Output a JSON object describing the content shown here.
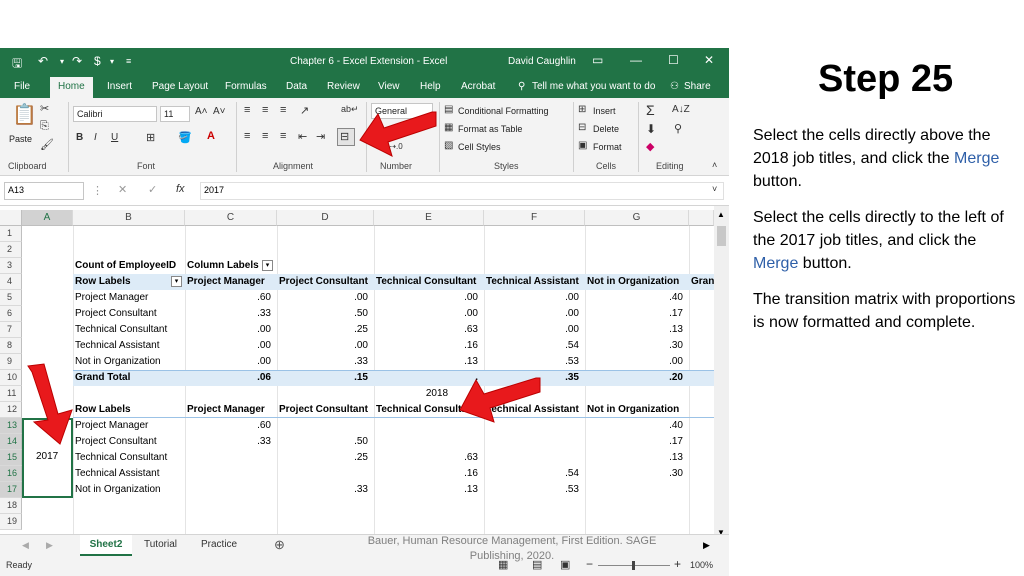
{
  "slide": {
    "step_title": "Step 25",
    "para1_before": "Select the cells directly above the 2018 job titles, and click the ",
    "para1_link": "Merge",
    "para1_after": " button.",
    "para2_before": "Select the cells directly to the left of the 2017 job titles, and click the ",
    "para2_link": "Merge",
    "para2_after": " button.",
    "para3": "The transition matrix with proportions is now formatted and complete.",
    "citation": "Bauer, Human Resource Management, First Edition. SAGE Publishing, 2020."
  },
  "window": {
    "title": "Chapter 6 - Excel Extension  -  Excel",
    "user": "David Caughlin"
  },
  "ribbon_tabs": [
    "File",
    "Home",
    "Insert",
    "Page Layout",
    "Formulas",
    "Data",
    "Review",
    "View",
    "Help",
    "Acrobat"
  ],
  "tell_me": "Tell me what you want to do",
  "share": "Share",
  "ribbon": {
    "paste": "Paste",
    "clipboard": "Clipboard",
    "font_name": "Calibri",
    "font_size": "11",
    "font": "Font",
    "alignment": "Alignment",
    "number_format": "General",
    "number": "Number",
    "conditional_formatting": "Conditional Formatting",
    "format_as_table": "Format as Table",
    "cell_styles": "Cell Styles",
    "styles": "Styles",
    "insert": "Insert",
    "delete": "Delete",
    "format": "Format",
    "cells": "Cells",
    "editing": "Editing"
  },
  "formula_bar": {
    "name_box": "A13",
    "fx": "fx",
    "value": "2017"
  },
  "columns": [
    "A",
    "B",
    "C",
    "D",
    "E",
    "F",
    "G"
  ],
  "rows": [
    "1",
    "2",
    "3",
    "4",
    "5",
    "6",
    "7",
    "8",
    "9",
    "10",
    "11",
    "12",
    "13",
    "14",
    "15",
    "16",
    "17",
    "18",
    "19"
  ],
  "pivot": {
    "count_label": "Count of EmployeeID",
    "column_labels": "Column Labels",
    "row_labels": "Row Labels",
    "headers": [
      "Project Manager",
      "Project Consultant",
      "Technical Consultant",
      "Technical Assistant",
      "Not in Organization",
      "Grand"
    ],
    "rows": [
      {
        "label": "Project Manager",
        "values": [
          ".60",
          ".00",
          ".00",
          ".00",
          ".40"
        ]
      },
      {
        "label": "Project Consultant",
        "values": [
          ".33",
          ".50",
          ".00",
          ".00",
          ".17"
        ]
      },
      {
        "label": "Technical Consultant",
        "values": [
          ".00",
          ".25",
          ".63",
          ".00",
          ".13"
        ]
      },
      {
        "label": "Technical Assistant",
        "values": [
          ".00",
          ".00",
          ".16",
          ".54",
          ".30"
        ]
      },
      {
        "label": "Not in Organization",
        "values": [
          ".00",
          ".33",
          ".13",
          ".53",
          ".00"
        ]
      }
    ],
    "grand_total_label": "Grand Total",
    "grand_total": [
      ".06",
      ".15",
      ".",
      ".35",
      ".20"
    ]
  },
  "matrix": {
    "year_top": "2018",
    "year_left": "2017",
    "row_labels": "Row Labels",
    "headers": [
      "Project Manager",
      "Project Consultant",
      "Technical Consultant",
      "Technical Assistant",
      "Not in Organization"
    ],
    "rows": [
      {
        "label": "Project Manager",
        "values": [
          ".60",
          "",
          "",
          "",
          ".40"
        ]
      },
      {
        "label": "Project Consultant",
        "values": [
          ".33",
          ".50",
          "",
          "",
          ".17"
        ]
      },
      {
        "label": "Technical Consultant",
        "values": [
          "",
          ".25",
          ".63",
          "",
          ".13"
        ]
      },
      {
        "label": "Technical Assistant",
        "values": [
          "",
          "",
          ".16",
          ".54",
          ".30"
        ]
      },
      {
        "label": "Not in Organization",
        "values": [
          "",
          ".33",
          ".13",
          ".53",
          ""
        ]
      }
    ]
  },
  "sheets": {
    "active": "Sheet2",
    "others": [
      "Tutorial",
      "Practice"
    ]
  },
  "status": {
    "ready": "Ready",
    "zoom": "100%"
  },
  "colors": {
    "excel_green": "#217346",
    "arrow_red": "#e8191c",
    "link_blue": "#2e5fa8",
    "pivot_header": "#ddebf7"
  }
}
